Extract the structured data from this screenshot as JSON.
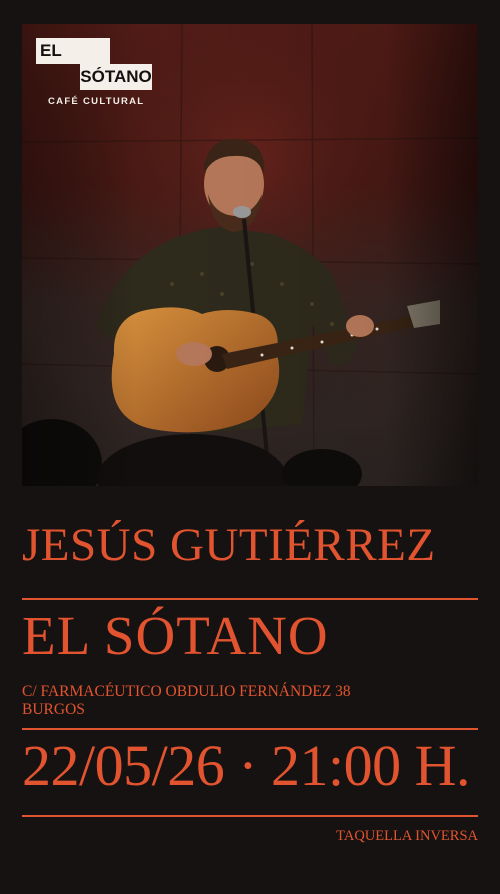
{
  "logo": {
    "line1": "EL",
    "line2": "SÓTANO",
    "subtitle": "CAFÉ CULTURAL"
  },
  "event": {
    "artist": "JESÚS GUTIÉRREZ",
    "venue": "EL SÓTANO",
    "address_line1": "C/ FARMACÉUTICO OBDULIO FERNÁNDEZ 38",
    "address_line2": "BURGOS",
    "datetime": "22/05/26 · 21:00 H.",
    "tickets": "TAQUELLA INVERSA"
  },
  "colors": {
    "background": "#161211",
    "accent": "#e2542f",
    "logo_bg": "#f4efe8"
  }
}
